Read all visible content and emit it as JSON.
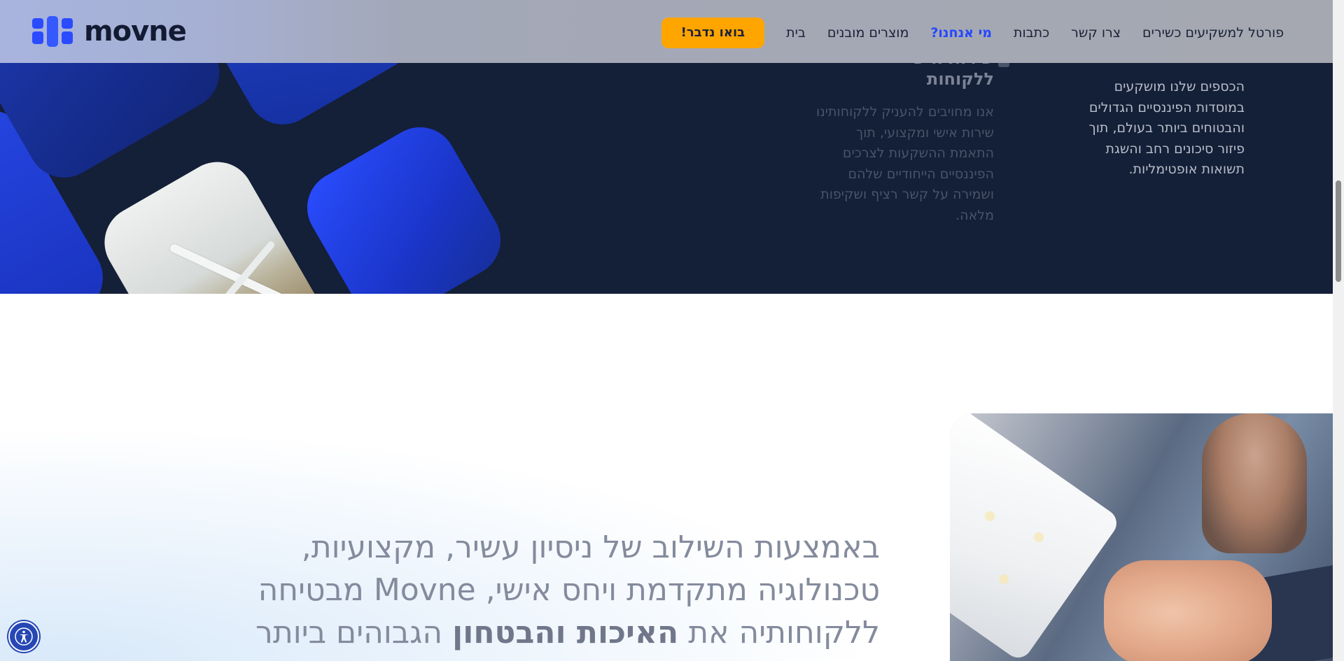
{
  "header": {
    "logo_text": "movne",
    "cta_label": "בואו נדבר!",
    "nav": [
      {
        "label": "בית",
        "active": false
      },
      {
        "label": "מוצרים מובנים",
        "active": false
      },
      {
        "label": "מי אנחנו?",
        "active": true
      },
      {
        "label": "כתבות",
        "active": false
      },
      {
        "label": "צרו קשר",
        "active": false
      },
      {
        "label": "פורטל למשקיעים כשירים",
        "active": false
      }
    ]
  },
  "dark_section": {
    "col_right_lines": [
      "הכספים שלנו מושקעים",
      "במוסדות הפיננסיים הגדולים",
      "והבטוחים ביותר בעולם, תוך",
      "פיזור סיכונים רחב והשגת",
      "תשואות אופטימליות."
    ],
    "col_mid_heading_lines": [
      "שירות אישי",
      "ללקוחות"
    ],
    "col_mid_lines": [
      "אנו מחויבים להעניק ללקוחותינו",
      "שירות אישי ומקצועי, תוך",
      "התאמת ההשקעות לצרכים",
      "הפיננסיים הייחודיים שלהם",
      "ושמירה על קשר רציף ושקיפות",
      "מלאה."
    ]
  },
  "main": {
    "lead_part1": "באמצעות השילוב של ניסיון עשיר, מקצועיות, טכנולוגיה מתקדמת ויחס אישי, Movne מבטיחה ללקוחותיה את ",
    "lead_bold": "האיכות והבטחון",
    "lead_part2": " הגבוהים ביותר"
  },
  "colors": {
    "accent": "#2547ff",
    "cta": "#ffa500",
    "dark_bg": "#141f38"
  },
  "icons": {
    "accessibility": "accessibility-icon",
    "logo": "logo-icon"
  }
}
